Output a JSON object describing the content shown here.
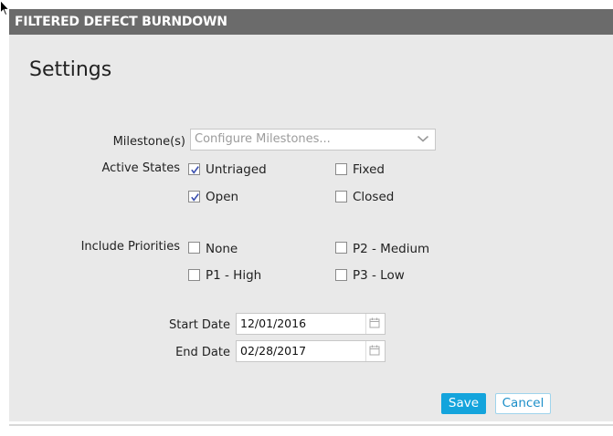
{
  "window": {
    "title": "FILTERED DEFECT BURNDOWN"
  },
  "settings": {
    "heading": "Settings",
    "milestones": {
      "label": "Milestone(s)",
      "placeholder": "Configure Milestones..."
    },
    "active_states": {
      "label": "Active States",
      "options": [
        {
          "label": "Untriaged",
          "checked": true
        },
        {
          "label": "Fixed",
          "checked": false
        },
        {
          "label": "Open",
          "checked": true
        },
        {
          "label": "Closed",
          "checked": false
        }
      ]
    },
    "priorities": {
      "label": "Include Priorities",
      "options": [
        {
          "label": "None",
          "checked": false
        },
        {
          "label": "P2 - Medium",
          "checked": false
        },
        {
          "label": "P1 - High",
          "checked": false
        },
        {
          "label": "P3 - Low",
          "checked": false
        }
      ]
    },
    "start_date": {
      "label": "Start Date",
      "value": "12/01/2016"
    },
    "end_date": {
      "label": "End Date",
      "value": "02/28/2017"
    }
  },
  "actions": {
    "save_label": "Save",
    "cancel_label": "Cancel"
  },
  "colors": {
    "titlebar": "#6b6b6b",
    "panel": "#e9e9e9",
    "primary_button": "#14a4dc",
    "cancel_text": "#1b8ec8"
  },
  "icons": [
    "mouse-cursor-icon",
    "chevron-down-icon",
    "calendar-icon",
    "checkmark-icon"
  ]
}
